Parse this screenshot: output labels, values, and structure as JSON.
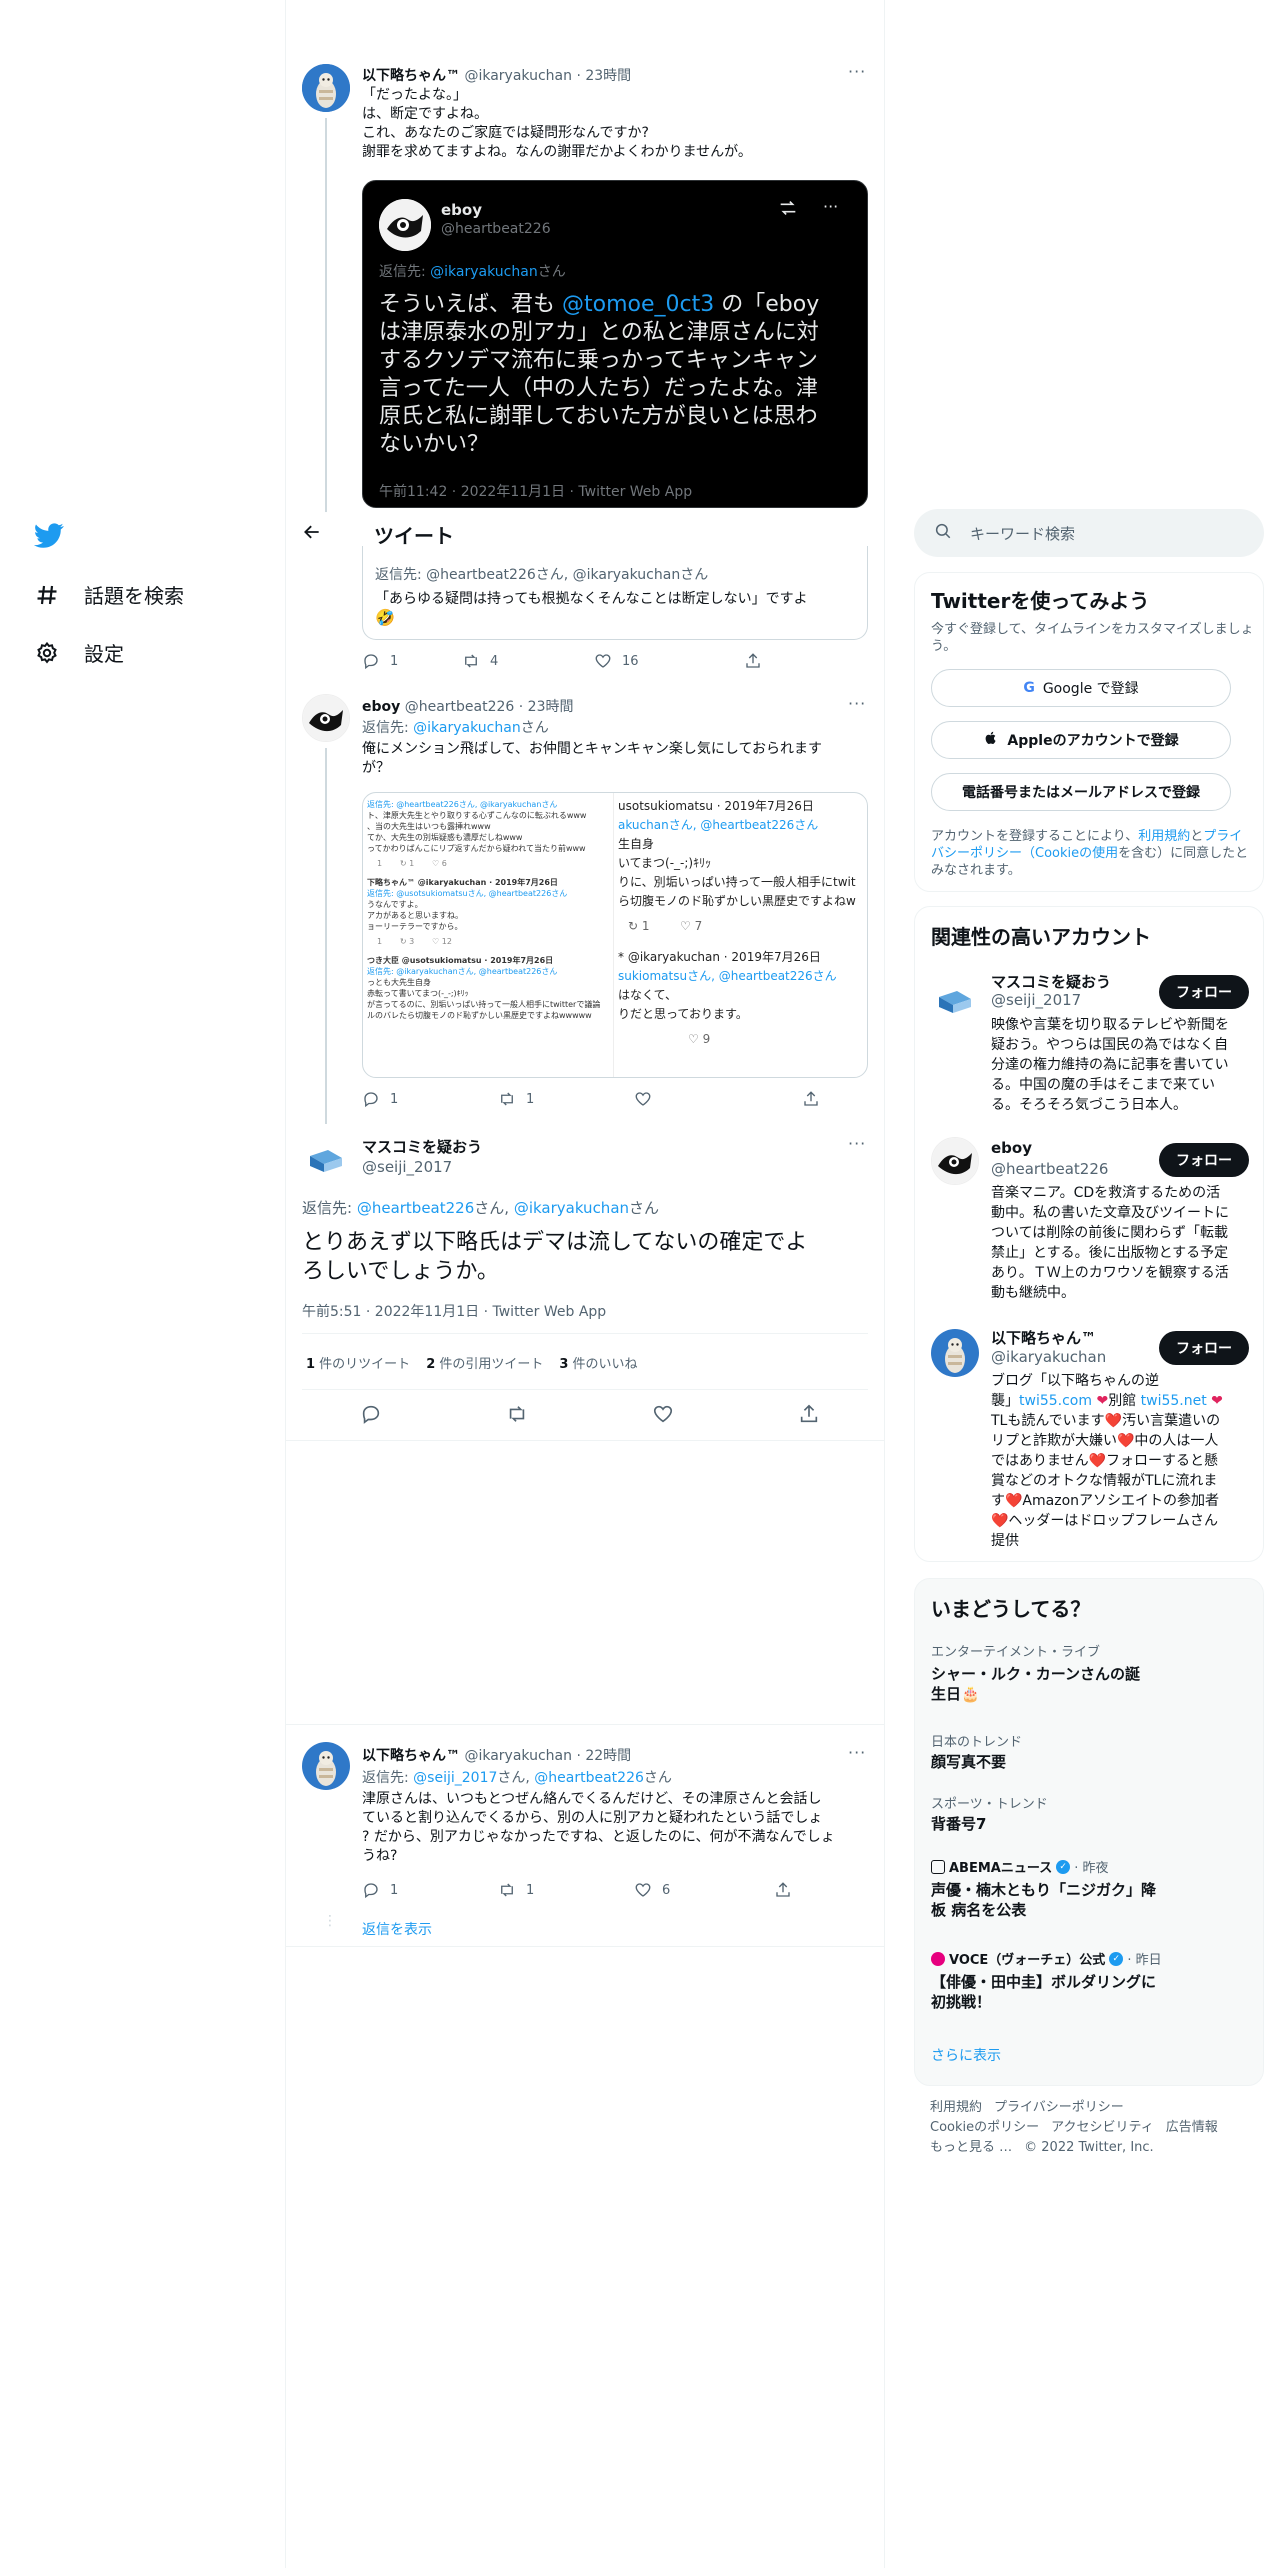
{
  "nav": {
    "explore_label": "話題を検索",
    "settings_label": "設定"
  },
  "header": {
    "title": "ツイート"
  },
  "tweet1": {
    "name": "以下略ちゃん™",
    "handle": "@ikaryakuchan",
    "time": "· 23時間",
    "lines": [
      "「だったよな。」",
      "は、断定ですよね。",
      "これ、あなたのご家庭では疑問形なんですか?",
      "謝罪を求めてますよね。なんの謝罪だかよくわかりませんが。"
    ]
  },
  "embedded": {
    "name": "eboy",
    "handle": "@heartbeat226",
    "reply_to_prefix": "返信先: ",
    "reply_to_handle": "@ikaryakuchan",
    "reply_to_suffix": "さん",
    "line1_pre": "そういえば、君も",
    "line1_mention": "@tomoe_0ct3",
    "line1_post": " の「eboy",
    "lines": [
      "は津原泰水の別アカ」との私と津原さんに対",
      "するクソデマ流布に乗っかってキャンキャン",
      "言ってた一人（中の人たち）だったよな。津",
      "原氏と私に謝罪しておいた方が良いとは思わ",
      "ないかい？"
    ],
    "meta": "午前11:42 · 2022年11月1日 · Twitter Web App"
  },
  "quote_fragment": {
    "reply_to": "返信先: @heartbeat226さん, @ikaryakuchanさん",
    "text": "「あらゆる疑問は持っても根拠なくそんなことは断定しない」ですよ",
    "emoji": "🤣"
  },
  "tweet1_actions": {
    "reply": "1",
    "retweet": "4",
    "like": "16"
  },
  "tweet2": {
    "name": "eboy",
    "handle": "@heartbeat226",
    "time": "· 23時間",
    "reply_prefix": "返信先: ",
    "reply_handle": "@ikaryakuchan",
    "reply_suffix": "さん",
    "lines": [
      "俺にメンション飛ばして、お仲間とキャンキャン楽し気にしておられます",
      "が？"
    ],
    "image": {
      "left_rows": [
        "返信先: @heartbeat226さん, @ikaryakuchanさん",
        "ト、津原大先生とやり取りする心ずこんなのに転ぶれるwww",
        "、当の大先生はいつも露挿れwww",
        "てか、大先生の別垢疑惑も濃厚だしねwww",
        "ってかわりばんこにリプ返すんだから疑われて当たり前www",
        "下略ちゃん™ @ikaryakuchan · 2019年7月26日",
        "返信先: @usotsukiomatsuさん, @heartbeat226さん",
        "うなんですよ。",
        "アカがあると思いますね。",
        "ョーリーテラーですから。",
        "つき大臣 @usotsukiomatsu · 2019年7月26日",
        "返信先: @ikaryakuchanさん, @heartbeat226さん",
        "っとも大先生自身",
        "赤転って書いてまつ(-_-;)ｷﾘｯ",
        "が言ってるのに、別垢いっぱい持って一般人相手にtwitterで議論",
        "ルのバレたら切腹モノのド恥ずかしい黒歴史ですよねwwwww"
      ],
      "right_rows": [
        "usotsukiomatsu · 2019年7月26日",
        "akuchanさん, @heartbeat226さん",
        "生自身",
        "いてまつ(-_-;)ｷﾘｯ",
        "りに、別垢いっぱい持って一般人相手にtwit",
        "ら切腹モノのド恥ずかしい黒歴史ですよねw",
        "* @ikaryakuchan · 2019年7月26日",
        "sukiomatsuさん, @heartbeat226さん",
        "はなくて、",
        "りだと思っております。"
      ],
      "stat_7": "7",
      "stat_9": "9",
      "stat_1": "1",
      "stat_12": "12",
      "stat_3": "3",
      "stat_6": "6"
    },
    "actions": {
      "reply": "1",
      "retweet": "1"
    }
  },
  "main_tweet": {
    "name": "マスコミを疑おう",
    "handle": "@seiji_2017",
    "reply_prefix": "返信先: ",
    "reply_h1": "@heartbeat226",
    "reply_mid": "さん, ",
    "reply_h2": "@ikaryakuchan",
    "reply_suffix": "さん",
    "line1": "とりあえず以下略氏はデマは流してないの確定でよ",
    "line2": "ろしいでしょうか。",
    "meta": "午前5:51 · 2022年11月1日 · Twitter Web App",
    "stats": [
      {
        "num": "1",
        "label": " 件のリツイート"
      },
      {
        "num": "2",
        "label": " 件の引用ツイート"
      },
      {
        "num": "3",
        "label": " 件のいいね"
      }
    ]
  },
  "reply_tweet": {
    "name": "以下略ちゃん™",
    "handle": "@ikaryakuchan",
    "time": "· 22時間",
    "reply_prefix": "返信先: ",
    "reply_h1": "@seiji_2017",
    "reply_mid": "さん, ",
    "reply_h2": "@heartbeat226",
    "reply_suffix": "さん",
    "lines": [
      "津原さんは、いつもとつぜん絡んでくるんだけど、その津原さんと会話し",
      "ていると割り込んでくるから、別の人に別アカと疑われたという話でしょ",
      "? だから、別アカじゃなかったですね、と返したのに、何が不満なんでしょ",
      "うね?"
    ],
    "actions": {
      "reply": "1",
      "retweet": "1",
      "like": "6"
    },
    "show_replies": "返信を表示"
  },
  "search": {
    "placeholder": "キーワード検索"
  },
  "signup": {
    "title": "Twitterを使ってみよう",
    "desc1": "今すぐ登録して、タイムラインをカスタマイズしましょ",
    "desc2": "う。",
    "google": "Google で登録",
    "apple": "Appleのアカウントで登録",
    "phone": "電話番号またはメールアドレスで登録",
    "terms1_pre": "アカウントを登録することにより、",
    "terms1_link": "利用規約",
    "terms1_mid": "と",
    "terms1_link2": "プライ",
    "terms2_link": "バシーポリシー（Cookieの使用",
    "terms2_post": "を含む）に同意したと",
    "terms3": "みなされます。"
  },
  "related": {
    "title": "関連性の高いアカウント",
    "follow_label": "フォロー",
    "accounts": [
      {
        "name": "マスコミを疑おう",
        "handle": "@seiji_2017",
        "bio": [
          "映像や言葉を切り取るテレビや新聞を",
          "疑おう。やつらは国民の為ではなく自",
          "分達の権力維持の為に記事を書いてい",
          "る。中国の魔の手はそこまで来てい",
          "る。そろそろ気づこう日本人。"
        ]
      },
      {
        "name": "eboy",
        "handle": "@heartbeat226",
        "bio": [
          "音楽マニア。CDを救済するための活",
          "動中。私の書いた文章及びツイートに",
          "ついては削除の前後に関わらず「転載",
          "禁止」とする。後に出版物とする予定",
          "あり。ＴＷ上のカワウソを観察する活",
          "動も継続中。"
        ]
      },
      {
        "name": "以下略ちゃん™",
        "handle": "@ikaryakuchan",
        "bio_line1": "ブログ「以下略ちゃんの逆",
        "bio_line2_pre": "襲」",
        "bio_link1": "twi55.com",
        "bio_mid": "別館 ",
        "bio_link2": "twi55.net",
        "bio_rest": [
          "TLも読んでいます❤️汚い言葉遣いの",
          "リプと詐欺が大嫌い❤️中の人は一人",
          "ではありません❤️フォローすると懸",
          "賞などのオトクな情報がTLに流れま",
          "す❤️Amazonアソシエイトの参加者",
          "❤️ヘッダーはドロップフレームさん",
          "提供"
        ]
      }
    ]
  },
  "trends": {
    "title": "いまどうしてる？",
    "items": [
      {
        "cat": "エンターテイメント・ライブ",
        "name1": "シャー・ルク・カーンさんの誕",
        "name2": "生日🎂"
      },
      {
        "cat": "日本のトレンド",
        "name1": "顔写真不要",
        "name2": ""
      },
      {
        "cat": "スポーツ・トレンド",
        "name1": "背番号7",
        "name2": ""
      },
      {
        "cat": "ABEMAニュース",
        "meta": "· 昨夜",
        "name1": "声優・楠木ともり「ニジガク」降",
        "name2": "板 病名を公表"
      },
      {
        "cat": "VOCE（ヴォーチェ）公式",
        "meta": "· 昨日",
        "name1": "【俳優・田中圭】ボルダリングに",
        "name2": "初挑戦！"
      }
    ],
    "show_more": "さらに表示"
  },
  "footer": {
    "row1": [
      "利用規約",
      "プライバシーポリシー"
    ],
    "row2": [
      "Cookieのポリシー",
      "アクセシビリティ",
      "広告情報"
    ],
    "row3_more": "もっと見る …",
    "copyright": "© 2022 Twitter, Inc."
  },
  "colors": {
    "accent": "#1d9bf0",
    "text": "#0f1419",
    "muted": "#536471",
    "heart": "#f91880"
  }
}
